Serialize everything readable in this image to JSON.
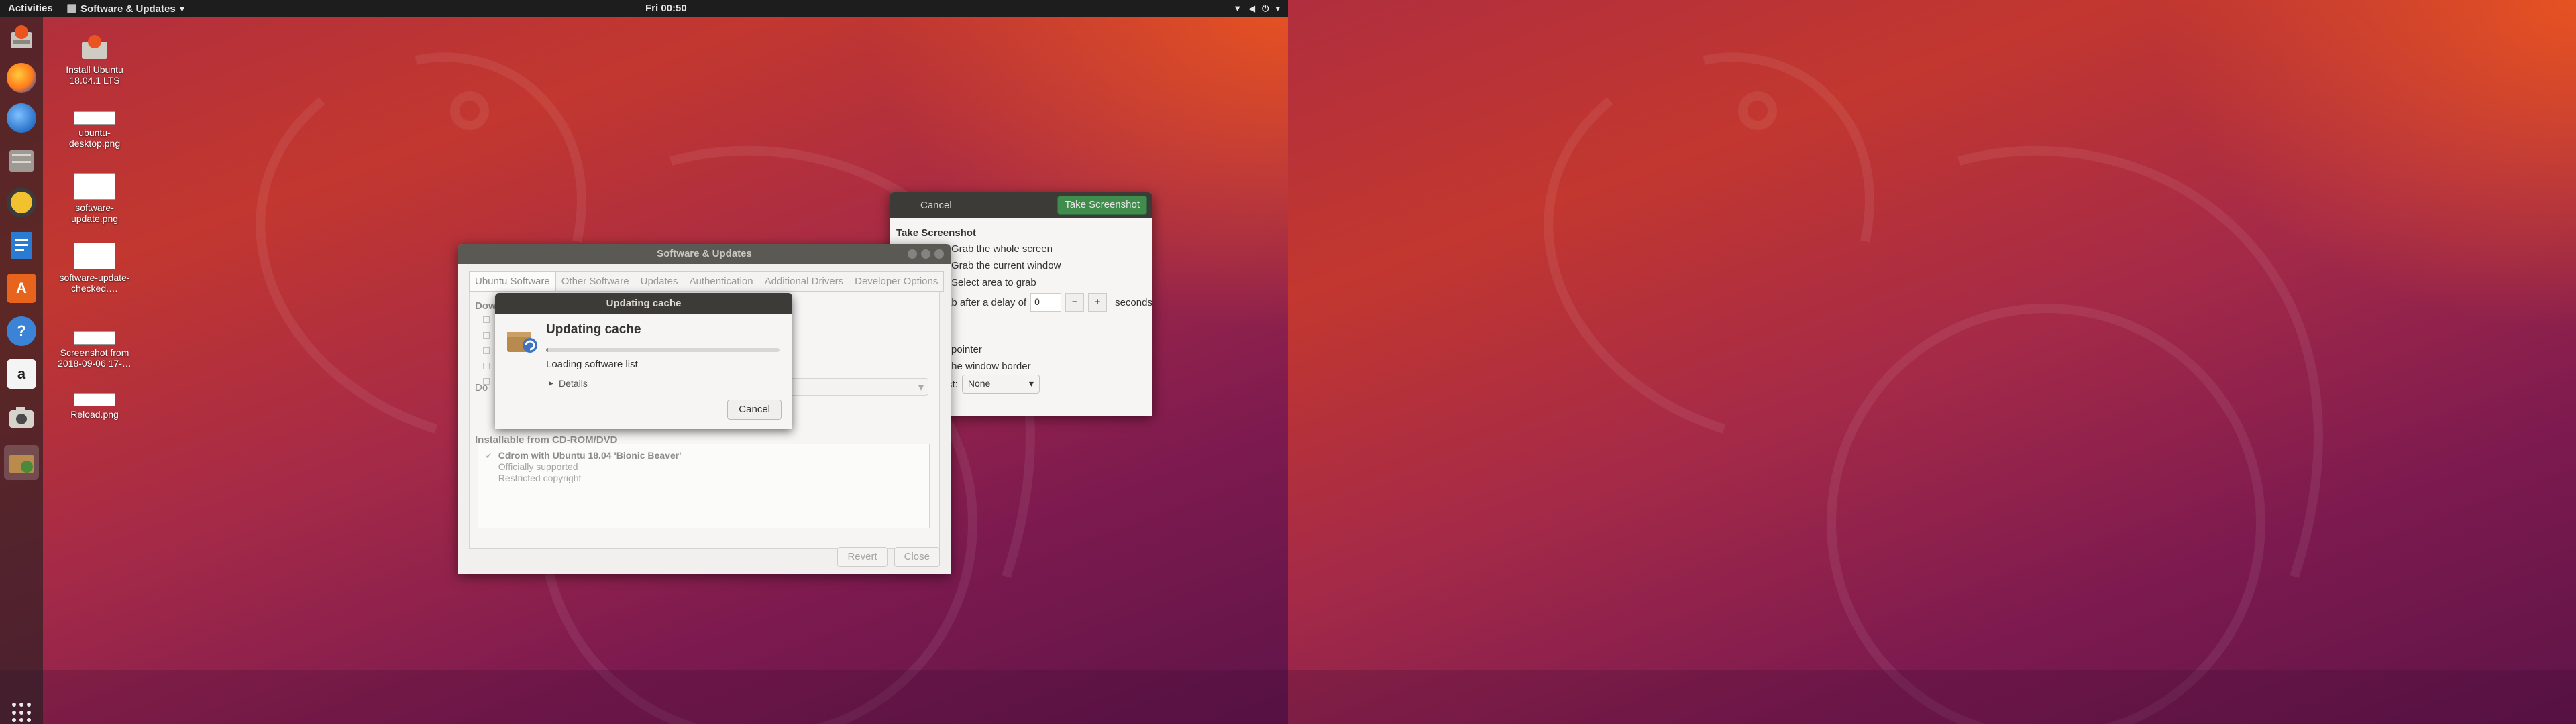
{
  "topbar": {
    "activities": "Activities",
    "app_menu": "Software & Updates",
    "app_menu_arrow": "▾",
    "clock": "Fri 00:50",
    "tray_icons": [
      "network-icon",
      "volume-icon",
      "power-icon",
      "menu-arrow-icon"
    ]
  },
  "dock": {
    "items": [
      {
        "name": "install-ubuntu-dock"
      },
      {
        "name": "firefox-dock"
      },
      {
        "name": "thunderbird-dock"
      },
      {
        "name": "files-dock"
      },
      {
        "name": "rhythmbox-dock"
      },
      {
        "name": "libreoffice-writer-dock"
      },
      {
        "name": "ubuntu-software-dock"
      },
      {
        "name": "help-dock"
      },
      {
        "name": "amazon-dock"
      },
      {
        "name": "screenshot-dock"
      },
      {
        "name": "software-updates-dock"
      }
    ],
    "help_glyph": "?",
    "amazon_glyph": "a",
    "software_glyph": "A"
  },
  "desktop_icons": [
    {
      "label": "Install Ubuntu 18.04.1 LTS"
    },
    {
      "label": "ubuntu-desktop.png"
    },
    {
      "label": "software-update.png"
    },
    {
      "label": "software-update-checked.…"
    },
    {
      "label": "Screenshot from 2018-09-06 17-…"
    },
    {
      "label": "Reload.png"
    }
  ],
  "screenshot_dialog": {
    "cancel": "Cancel",
    "take": "Take Screenshot",
    "heading": "Take Screenshot",
    "opt_whole": "Grab the whole screen",
    "opt_window": "Grab the current window",
    "opt_area": "Select area to grab",
    "delay_prefix": "ab after a delay of",
    "delay_value": "0",
    "minus": "−",
    "plus": "+",
    "delay_suffix": "seconds",
    "pointer": "pointer",
    "border": "the window border",
    "effect_label": "ct:",
    "effect_value": "None"
  },
  "software_window": {
    "title": "Software & Updates",
    "tabs": [
      "Ubuntu Software",
      "Other Software",
      "Updates",
      "Authentication",
      "Additional Drivers",
      "Developer Options"
    ],
    "downloadable_partial": "Dow",
    "download_from_partial": "Do",
    "cdrom_heading": "Installable from CD-ROM/DVD",
    "cdrom_name": "Cdrom with Ubuntu 18.04 'Bionic Beaver'",
    "cdrom_line1": "Officially supported",
    "cdrom_line2": "Restricted copyright",
    "revert": "Revert",
    "close": "Close"
  },
  "cache_dialog": {
    "title": "Updating cache",
    "heading": "Updating cache",
    "status": "Loading software list",
    "details": "Details",
    "cancel": "Cancel",
    "progress_fraction": 0.01
  }
}
